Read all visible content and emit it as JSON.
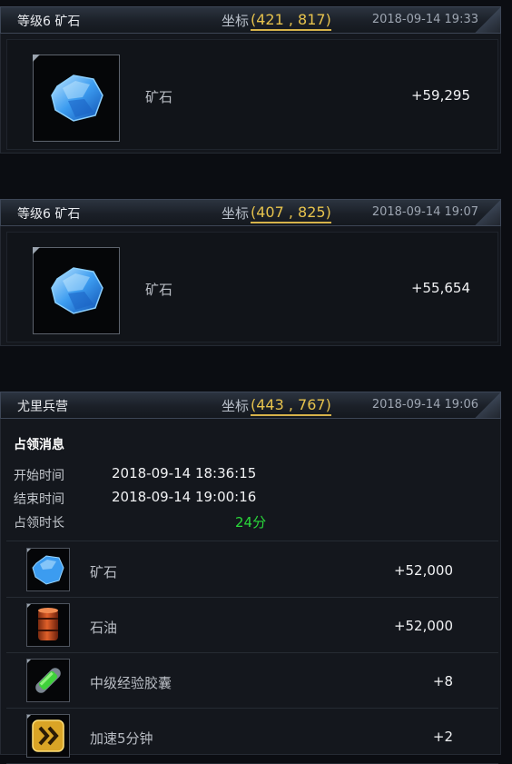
{
  "cards": [
    {
      "title": "等级6  矿石",
      "coord_label": "坐标",
      "coord": "(421 , 817)",
      "time": "2018-09-14 19:33",
      "item": {
        "name": "矿石",
        "amount": "+59,295",
        "icon": "blue-crystal-icon"
      }
    },
    {
      "title": "等级6  矿石",
      "coord_label": "坐标",
      "coord": "(407 , 825)",
      "time": "2018-09-14 19:07",
      "item": {
        "name": "矿石",
        "amount": "+55,654",
        "icon": "blue-crystal-icon"
      }
    }
  ],
  "occupy_card": {
    "title": "尤里兵营",
    "coord_label": "坐标",
    "coord": "(443 , 767)",
    "time": "2018-09-14 19:06",
    "section_title": "占领消息",
    "start_label": "开始时间",
    "start_value": "2018-09-14 18:36:15",
    "end_label": "结束时间",
    "end_value": "2018-09-14 19:00:16",
    "duration_label": "占领时长",
    "duration_value": "24分",
    "items": [
      {
        "name": "矿石",
        "amount": "+52,000",
        "icon": "blue-crystal-icon"
      },
      {
        "name": "石油",
        "amount": "+52,000",
        "icon": "oil-barrel-icon"
      },
      {
        "name": "中级经验胶囊",
        "amount": "+8",
        "icon": "green-capsule-icon"
      },
      {
        "name": "加速5分钟",
        "amount": "+2",
        "icon": "speedup-arrow-icon"
      }
    ]
  },
  "colors": {
    "coord": "#e7c34d",
    "green": "#29d93a",
    "background": "#0b0d12"
  }
}
